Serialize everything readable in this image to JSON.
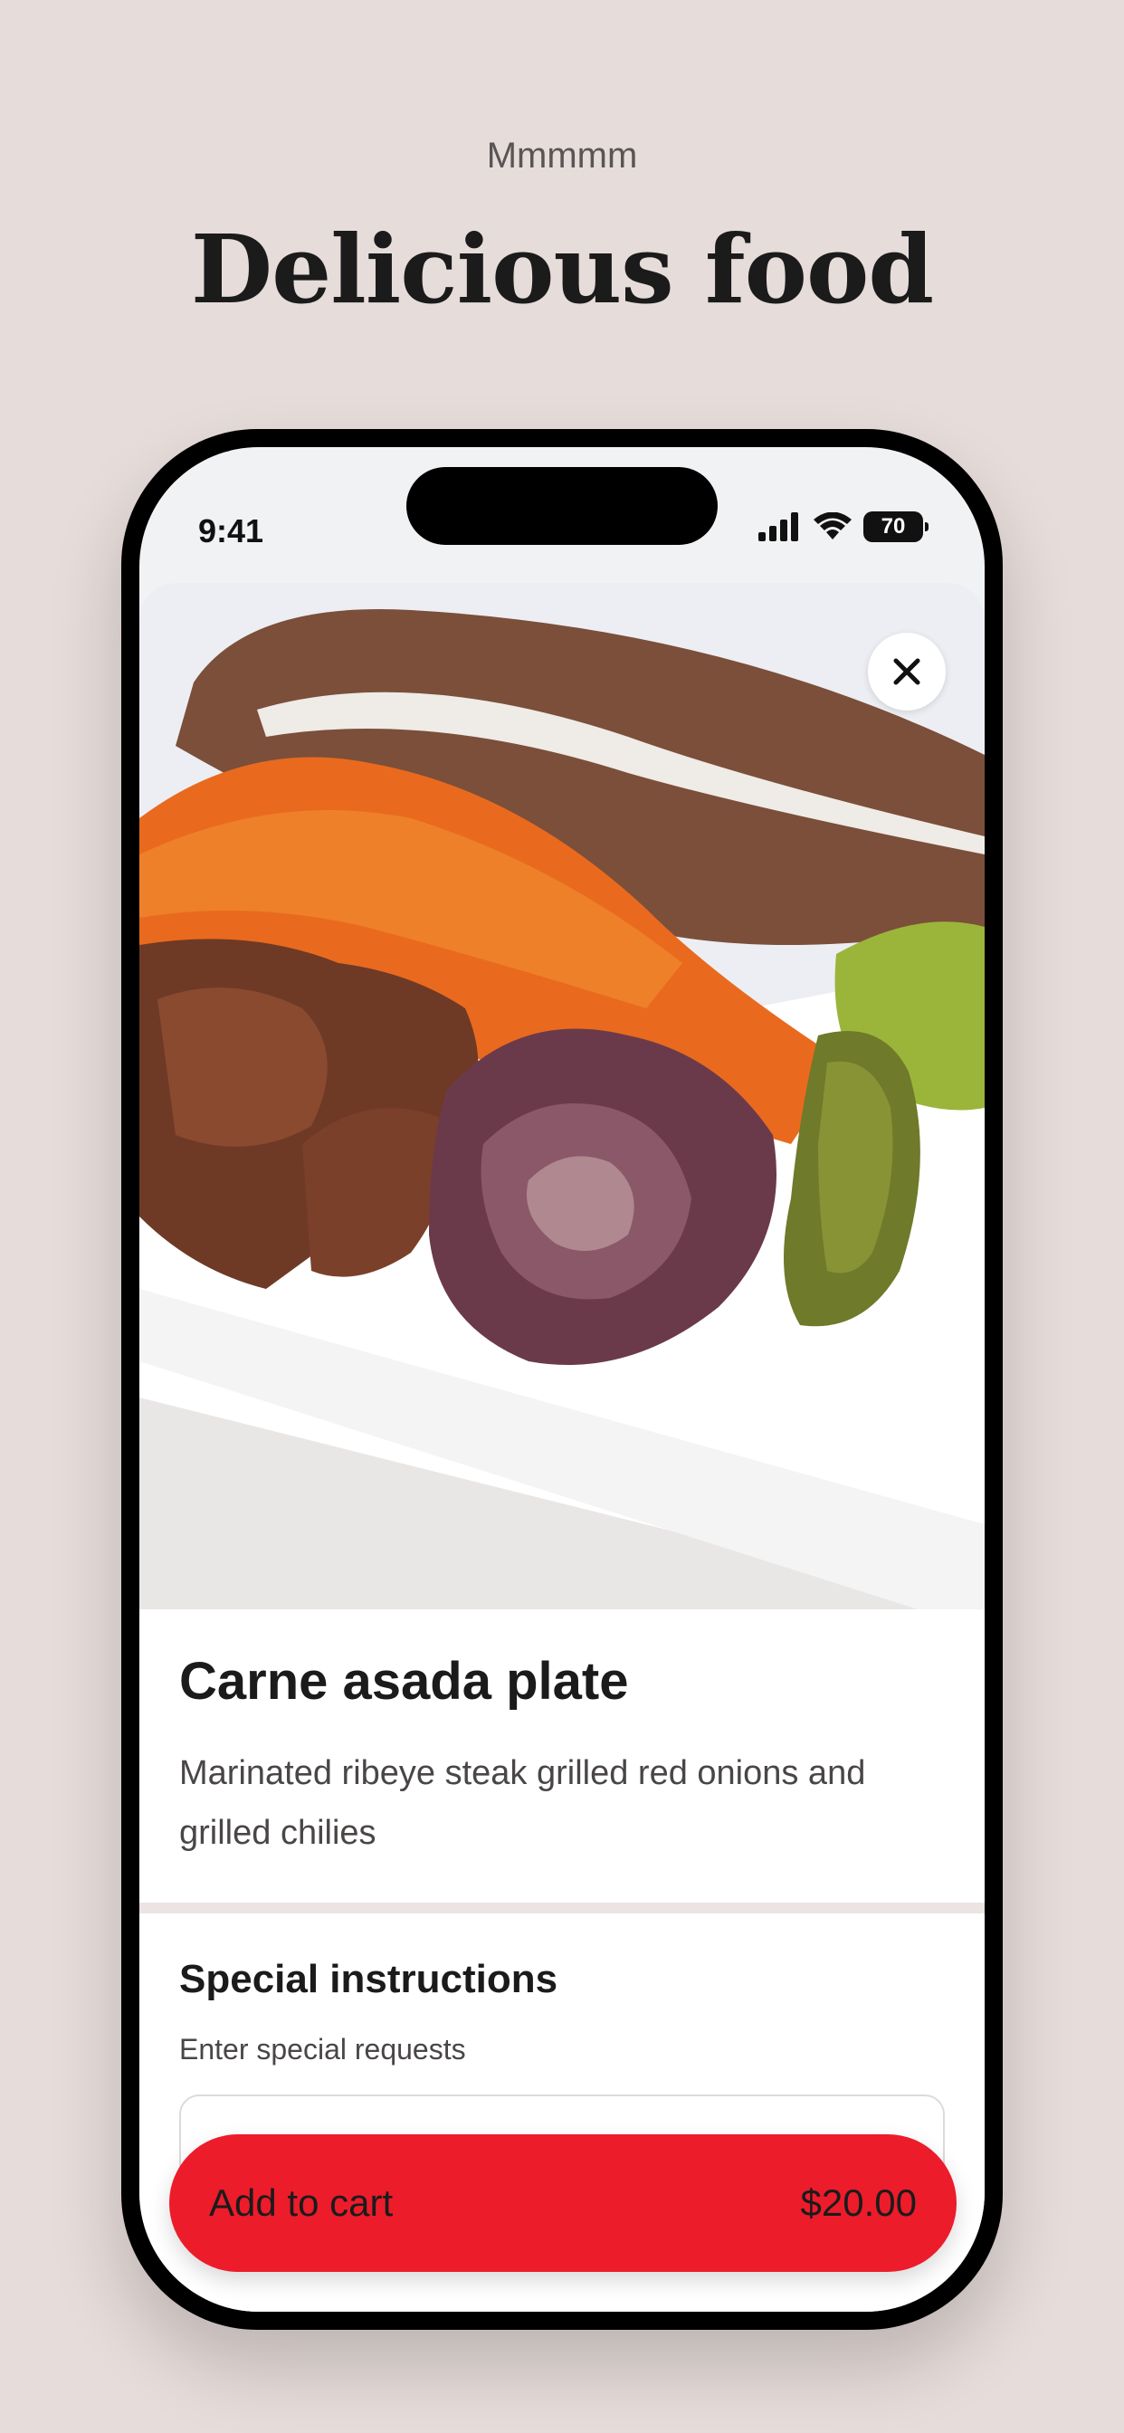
{
  "header": {
    "kicker": "Mmmmm",
    "title": "Delicious food"
  },
  "status_bar": {
    "time": "9:41",
    "battery": "70",
    "icons": [
      "signal-icon",
      "wifi-icon",
      "battery-icon"
    ]
  },
  "item": {
    "name": "Carne asada plate",
    "description": "Marinated ribeye steak grilled red onions and grilled chilies"
  },
  "special_instructions": {
    "title": "Special instructions",
    "subtitle": "Enter special requests",
    "value": ""
  },
  "cart": {
    "label": "Add to cart",
    "price": "$20.00"
  },
  "colors": {
    "background": "#e6dcda",
    "accent": "#ec1c2b",
    "text": "#1b1b1b"
  }
}
